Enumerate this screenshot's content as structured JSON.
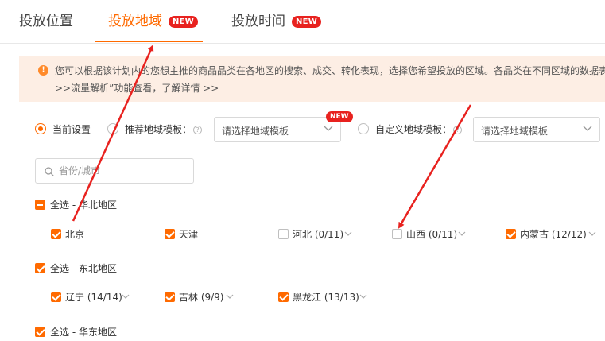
{
  "tabs": [
    {
      "label": "投放位置",
      "active": false
    },
    {
      "label": "投放地域",
      "active": true,
      "badge": "NEW"
    },
    {
      "label": "投放时间",
      "active": false,
      "badge": "NEW"
    }
  ],
  "notice": {
    "line1": "您可以根据该计划内的您想主推的商品品类在各地区的搜索、成交、转化表现，选择您希望投放的区域。各品类在不同区域的数据表",
    "line2": ">>流量解析”功能查看，了解详情 >>"
  },
  "template_row": {
    "current_label": "当前设置",
    "recommend_label": "推荐地域模板：",
    "recommend_placeholder": "请选择地域模板",
    "recommend_badge": "NEW",
    "custom_label": "自定义地域模板：",
    "custom_placeholder": "请选择地域模板"
  },
  "search": {
    "placeholder": "省份/城市"
  },
  "regions": [
    {
      "group_label": "全选 - 华北地区",
      "group_state": "partial",
      "items": [
        {
          "label": "北京",
          "checked": true,
          "expandable": false
        },
        {
          "label": "天津",
          "checked": true,
          "expandable": false
        },
        {
          "label": "河北 (0/11)",
          "checked": false,
          "expandable": true
        },
        {
          "label": "山西 (0/11)",
          "checked": false,
          "expandable": true
        },
        {
          "label": "内蒙古 (12/12)",
          "checked": true,
          "expandable": true
        }
      ]
    },
    {
      "group_label": "全选 - 东北地区",
      "group_state": "checked",
      "items": [
        {
          "label": "辽宁 (14/14)",
          "checked": true,
          "expandable": true
        },
        {
          "label": "吉林 (9/9)",
          "checked": true,
          "expandable": true
        },
        {
          "label": "黑龙江 (13/13)",
          "checked": true,
          "expandable": true
        }
      ]
    },
    {
      "group_label": "全选 - 华东地区",
      "group_state": "checked",
      "items": []
    }
  ],
  "colors": {
    "accent": "#ff6a00",
    "badge": "#e8221f",
    "notice_bg": "#fdeee4",
    "annotation_arrow": "#e8221f"
  }
}
